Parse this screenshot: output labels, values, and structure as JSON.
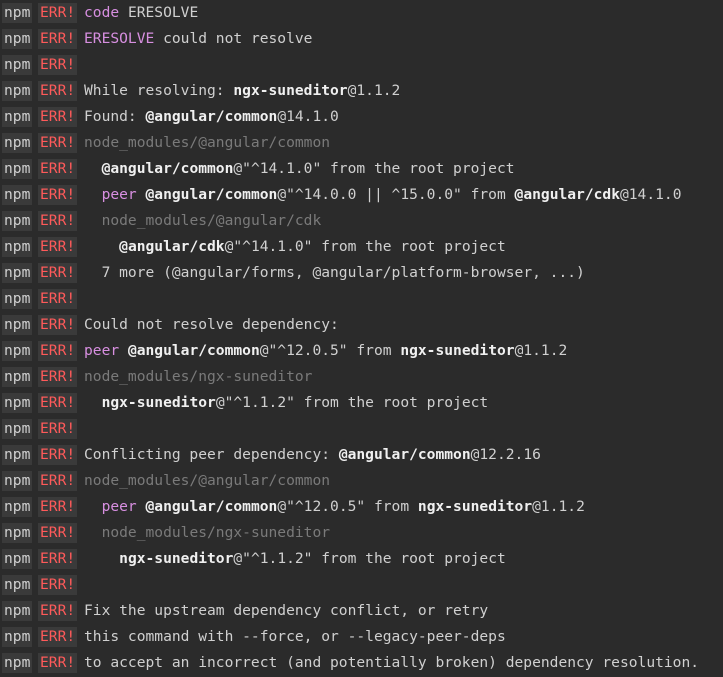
{
  "terminal": {
    "prefix": "npm",
    "error_tag": "ERR!",
    "colors": {
      "background": "#2b2b2b",
      "err": "#ff5a5a",
      "magenta": "#d78fe0",
      "dim": "#7a7a7a",
      "text": "#d0d0d0"
    },
    "lines": [
      {
        "indent": 0,
        "segments": [
          {
            "t": "code ",
            "s": "magenta"
          },
          {
            "t": "ERESOLVE",
            "s": "normal"
          }
        ]
      },
      {
        "indent": 0,
        "segments": [
          {
            "t": "ERESOLVE",
            "s": "magenta"
          },
          {
            "t": " could not resolve",
            "s": "normal"
          }
        ]
      },
      {
        "indent": 0,
        "segments": []
      },
      {
        "indent": 0,
        "segments": [
          {
            "t": "While resolving: ",
            "s": "normal"
          },
          {
            "t": "ngx-suneditor",
            "s": "bold"
          },
          {
            "t": "@1.1.2",
            "s": "normal"
          }
        ]
      },
      {
        "indent": 0,
        "segments": [
          {
            "t": "Found: ",
            "s": "normal"
          },
          {
            "t": "@angular/common",
            "s": "bold"
          },
          {
            "t": "@14.1.0",
            "s": "normal"
          }
        ]
      },
      {
        "indent": 0,
        "segments": [
          {
            "t": "node_modules/@angular/common",
            "s": "dim"
          }
        ]
      },
      {
        "indent": 2,
        "segments": [
          {
            "t": "@angular/common",
            "s": "bold"
          },
          {
            "t": "@\"^14.1.0\" from the root project",
            "s": "normal"
          }
        ]
      },
      {
        "indent": 2,
        "segments": [
          {
            "t": "peer ",
            "s": "magenta"
          },
          {
            "t": "@angular/common",
            "s": "bold"
          },
          {
            "t": "@\"^14.0.0 || ^15.0.0\" from ",
            "s": "normal"
          },
          {
            "t": "@angular/cdk",
            "s": "bold"
          },
          {
            "t": "@14.1.0",
            "s": "normal"
          }
        ]
      },
      {
        "indent": 2,
        "segments": [
          {
            "t": "node_modules/@angular/cdk",
            "s": "dim"
          }
        ]
      },
      {
        "indent": 4,
        "segments": [
          {
            "t": "@angular/cdk",
            "s": "bold"
          },
          {
            "t": "@\"^14.1.0\" from the root project",
            "s": "normal"
          }
        ]
      },
      {
        "indent": 2,
        "segments": [
          {
            "t": "7 more (@angular/forms, @angular/platform-browser, ...)",
            "s": "normal"
          }
        ]
      },
      {
        "indent": 0,
        "segments": []
      },
      {
        "indent": 0,
        "segments": [
          {
            "t": "Could not resolve dependency:",
            "s": "normal"
          }
        ]
      },
      {
        "indent": 0,
        "segments": [
          {
            "t": "peer ",
            "s": "magenta"
          },
          {
            "t": "@angular/common",
            "s": "bold"
          },
          {
            "t": "@\"^12.0.5\" from ",
            "s": "normal"
          },
          {
            "t": "ngx-suneditor",
            "s": "bold"
          },
          {
            "t": "@1.1.2",
            "s": "normal"
          }
        ]
      },
      {
        "indent": 0,
        "segments": [
          {
            "t": "node_modules/ngx-suneditor",
            "s": "dim"
          }
        ]
      },
      {
        "indent": 2,
        "segments": [
          {
            "t": "ngx-suneditor",
            "s": "bold"
          },
          {
            "t": "@\"^1.1.2\" from the root project",
            "s": "normal"
          }
        ]
      },
      {
        "indent": 0,
        "segments": []
      },
      {
        "indent": 0,
        "segments": [
          {
            "t": "Conflicting peer dependency: ",
            "s": "normal"
          },
          {
            "t": "@angular/common",
            "s": "bold"
          },
          {
            "t": "@12.2.16",
            "s": "normal"
          }
        ]
      },
      {
        "indent": 0,
        "segments": [
          {
            "t": "node_modules/@angular/common",
            "s": "dim"
          }
        ]
      },
      {
        "indent": 2,
        "segments": [
          {
            "t": "peer ",
            "s": "magenta"
          },
          {
            "t": "@angular/common",
            "s": "bold"
          },
          {
            "t": "@\"^12.0.5\" from ",
            "s": "normal"
          },
          {
            "t": "ngx-suneditor",
            "s": "bold"
          },
          {
            "t": "@1.1.2",
            "s": "normal"
          }
        ]
      },
      {
        "indent": 2,
        "segments": [
          {
            "t": "node_modules/ngx-suneditor",
            "s": "dim"
          }
        ]
      },
      {
        "indent": 4,
        "segments": [
          {
            "t": "ngx-suneditor",
            "s": "bold"
          },
          {
            "t": "@\"^1.1.2\" from the root project",
            "s": "normal"
          }
        ]
      },
      {
        "indent": 0,
        "segments": []
      },
      {
        "indent": 0,
        "segments": [
          {
            "t": "Fix the upstream dependency conflict, or retry",
            "s": "normal"
          }
        ]
      },
      {
        "indent": 0,
        "segments": [
          {
            "t": "this command with --force, or --legacy-peer-deps",
            "s": "normal"
          }
        ]
      },
      {
        "indent": 0,
        "segments": [
          {
            "t": "to accept an incorrect (and potentially broken) dependency resolution.",
            "s": "normal"
          }
        ]
      }
    ]
  }
}
